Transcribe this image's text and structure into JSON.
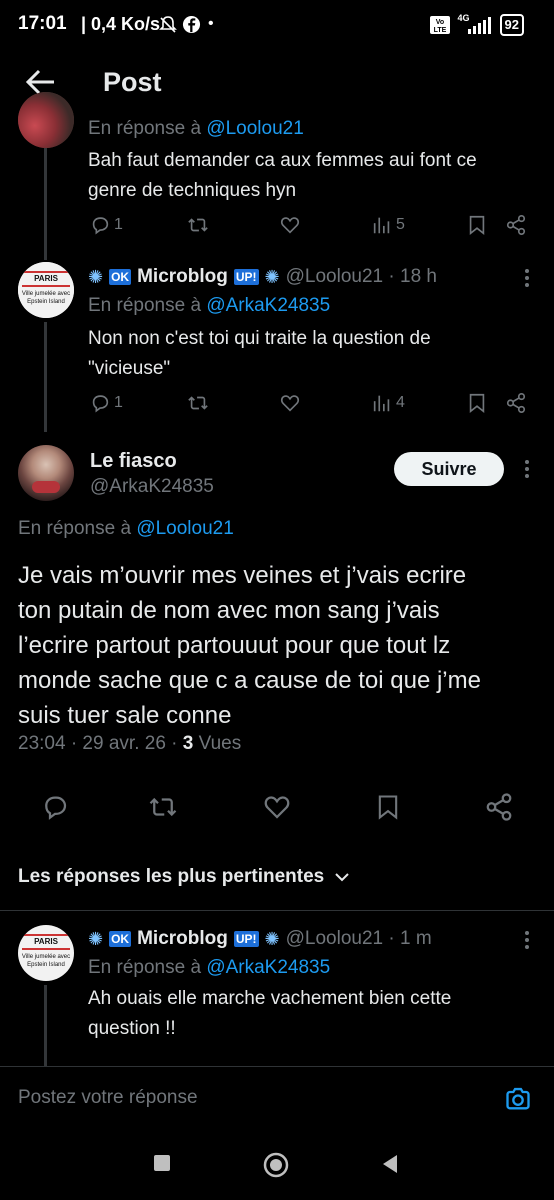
{
  "status_bar": {
    "time": "17:01",
    "net": "| 0,4 Ko/s",
    "network": "4G",
    "battery": "92"
  },
  "header": {
    "title": "Post"
  },
  "reply1": {
    "reply_prefix": "En réponse à",
    "reply_handle": "@Loolou21",
    "text_line1": "Bah faut demander ca aux femmes aui font ce",
    "text_line2": "genre de techniques hyn",
    "replies": "1",
    "views": "5"
  },
  "reply2": {
    "name": "Microblog",
    "badge_ok": "OK",
    "badge_up": "UP!",
    "handle": "@Loolou21 · 18 h",
    "reply_prefix": "En réponse à",
    "reply_handle": "@ArkaK24835",
    "avatar_top": "PARIS",
    "avatar_bottom_1": "Ville jumelée avec",
    "avatar_bottom_2": "Epstein Island",
    "text_line1": "Non non c'est toi qui traite la question de",
    "text_line2": "\"vicieuse\"",
    "replies": "1",
    "views": "4"
  },
  "main_post": {
    "name": "Le fiasco",
    "handle": "@ArkaK24835",
    "follow_label": "Suivre",
    "reply_prefix": "En réponse à",
    "reply_handle": "@Loolou21",
    "line1": "Je vais m’ouvrir mes veines et j’vais ecrire",
    "line2": "ton putain de nom avec mon sang j’vais",
    "line3": "l’ecrire partout partouuut pour que tout lz",
    "line4": "monde sache que c a cause de toi que j’me",
    "line5": "suis tuer sale conne",
    "meta_date": "23:04 · 29 avr. 26 · ",
    "meta_views_count": "3",
    "meta_views_label": " Vues"
  },
  "sort_label": "Les réponses les plus pertinentes",
  "reply3": {
    "name": "Microblog",
    "badge_ok": "OK",
    "badge_up": "UP!",
    "handle": "@Loolou21 · 1 m",
    "reply_prefix": "En réponse à",
    "reply_handle": "@ArkaK24835",
    "avatar_top": "PARIS",
    "avatar_bottom_1": "Ville jumelée avec",
    "avatar_bottom_2": "Epstein Island",
    "text_line1": "Ah ouais elle marche vachement bien cette",
    "text_line2": "question !!"
  },
  "compose": {
    "placeholder": "Postez votre réponse"
  },
  "colors": {
    "background": "#000000",
    "accent": "#1d9bf0",
    "secondary_text": "#71767b",
    "primary_text": "#e7e9ea"
  },
  "icons": [
    "back-arrow-icon",
    "reply-icon",
    "retweet-icon",
    "like-icon",
    "views-icon",
    "bookmark-icon",
    "share-icon",
    "more-icon",
    "chevron-down-icon",
    "camera-icon"
  ]
}
